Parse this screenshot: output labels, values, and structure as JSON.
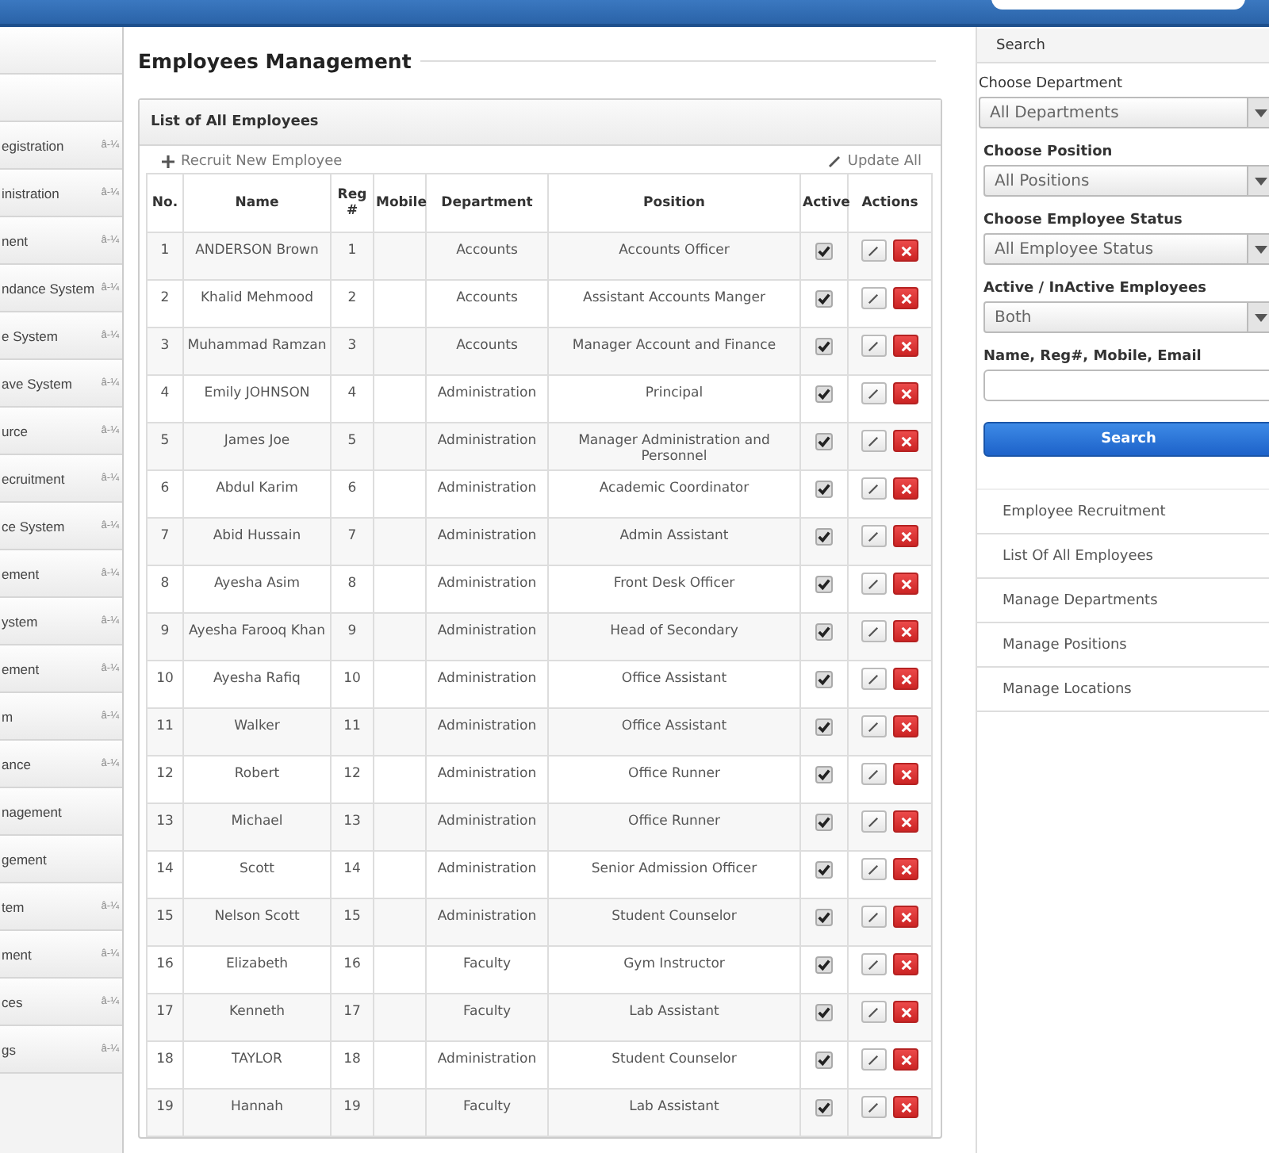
{
  "sidebar": {
    "items": [
      {
        "label": "egistration",
        "caret": "â-¼"
      },
      {
        "label": "inistration",
        "caret": "â-¼"
      },
      {
        "label": "nent",
        "caret": "â-¼"
      },
      {
        "label": "ndance System",
        "caret": "â-¼"
      },
      {
        "label": "e System",
        "caret": "â-¼"
      },
      {
        "label": "ave System",
        "caret": "â-¼"
      },
      {
        "label": "urce",
        "caret": "â-¼"
      },
      {
        "label": "ecruitment",
        "caret": "â-¼"
      },
      {
        "label": "ce System",
        "caret": "â-¼"
      },
      {
        "label": "ement",
        "caret": "â-¼"
      },
      {
        "label": "ystem",
        "caret": "â-¼"
      },
      {
        "label": "ement",
        "caret": "â-¼"
      },
      {
        "label": "m",
        "caret": "â-¼"
      },
      {
        "label": "ance",
        "caret": "â-¼"
      },
      {
        "label": "nagement"
      },
      {
        "label": "gement"
      },
      {
        "label": "tem",
        "caret": "â-¼"
      },
      {
        "label": "ment",
        "caret": "â-¼"
      },
      {
        "label": "ces",
        "caret": "â-¼"
      },
      {
        "label": "gs",
        "caret": "â-¼"
      }
    ]
  },
  "page_title": "Employees Management",
  "panel": {
    "title": "List of All Employees",
    "recruit_link": "Recruit New Employee",
    "update_link": "Update All"
  },
  "table": {
    "columns": [
      "No.",
      "Name",
      "Reg #",
      "Mobile",
      "Department",
      "Position",
      "Active",
      "Actions"
    ],
    "rows": [
      {
        "no": "1",
        "name": "ANDERSON Brown",
        "reg": "1",
        "department": "Accounts",
        "position": "Accounts Officer",
        "active": true
      },
      {
        "no": "2",
        "name": "Khalid Mehmood",
        "reg": "2",
        "department": "Accounts",
        "position": "Assistant Accounts Manger",
        "active": true
      },
      {
        "no": "3",
        "name": "Muhammad Ramzan",
        "reg": "3",
        "department": "Accounts",
        "position": "Manager Account and Finance",
        "active": true
      },
      {
        "no": "4",
        "name": "Emily JOHNSON",
        "reg": "4",
        "department": "Administration",
        "position": "Principal",
        "active": true
      },
      {
        "no": "5",
        "name": "James Joe",
        "reg": "5",
        "department": "Administration",
        "position": "Manager Administration and Personnel",
        "active": true
      },
      {
        "no": "6",
        "name": "Abdul Karim",
        "reg": "6",
        "department": "Administration",
        "position": "Academic Coordinator",
        "active": true
      },
      {
        "no": "7",
        "name": "Abid Hussain",
        "reg": "7",
        "department": "Administration",
        "position": "Admin Assistant",
        "active": true
      },
      {
        "no": "8",
        "name": "Ayesha Asim",
        "reg": "8",
        "department": "Administration",
        "position": "Front Desk Officer",
        "active": true
      },
      {
        "no": "9",
        "name": "Ayesha Farooq Khan",
        "reg": "9",
        "department": "Administration",
        "position": "Head of Secondary",
        "active": true
      },
      {
        "no": "10",
        "name": "Ayesha Rafiq",
        "reg": "10",
        "department": "Administration",
        "position": "Office Assistant",
        "active": true
      },
      {
        "no": "11",
        "name": "Walker",
        "reg": "11",
        "department": "Administration",
        "position": "Office Assistant",
        "active": true
      },
      {
        "no": "12",
        "name": "Robert",
        "reg": "12",
        "department": "Administration",
        "position": "Office Runner",
        "active": true
      },
      {
        "no": "13",
        "name": "Michael",
        "reg": "13",
        "department": "Administration",
        "position": "Office Runner",
        "active": true
      },
      {
        "no": "14",
        "name": "Scott",
        "reg": "14",
        "department": "Administration",
        "position": "Senior Admission Officer",
        "active": true
      },
      {
        "no": "15",
        "name": "Nelson Scott",
        "reg": "15",
        "department": "Administration",
        "position": "Student Counselor",
        "active": true
      },
      {
        "no": "16",
        "name": "Elizabeth",
        "reg": "16",
        "department": "Faculty",
        "position": "Gym Instructor",
        "active": true
      },
      {
        "no": "17",
        "name": "Kenneth",
        "reg": "17",
        "department": "Faculty",
        "position": "Lab Assistant",
        "active": true
      },
      {
        "no": "18",
        "name": "TAYLOR",
        "reg": "18",
        "department": "Administration",
        "position": "Student Counselor",
        "active": true
      },
      {
        "no": "19",
        "name": "Hannah",
        "reg": "19",
        "department": "Faculty",
        "position": "Lab Assistant",
        "active": true
      }
    ]
  },
  "search_panel": {
    "title": "Search",
    "filters": [
      {
        "label": "Choose Department",
        "value": "All Departments"
      },
      {
        "label": "Choose Position",
        "value": "All Positions"
      },
      {
        "label": "Choose Employee Status",
        "value": "All Employee Status"
      },
      {
        "label": "Active / InActive Employees",
        "value": "Both"
      }
    ],
    "text_label": "Name, Reg#, Mobile, Email",
    "button": "Search",
    "links": [
      "Employee Recruitment",
      "List Of All Employees",
      "Manage Departments",
      "Manage Positions",
      "Manage Locations"
    ]
  }
}
